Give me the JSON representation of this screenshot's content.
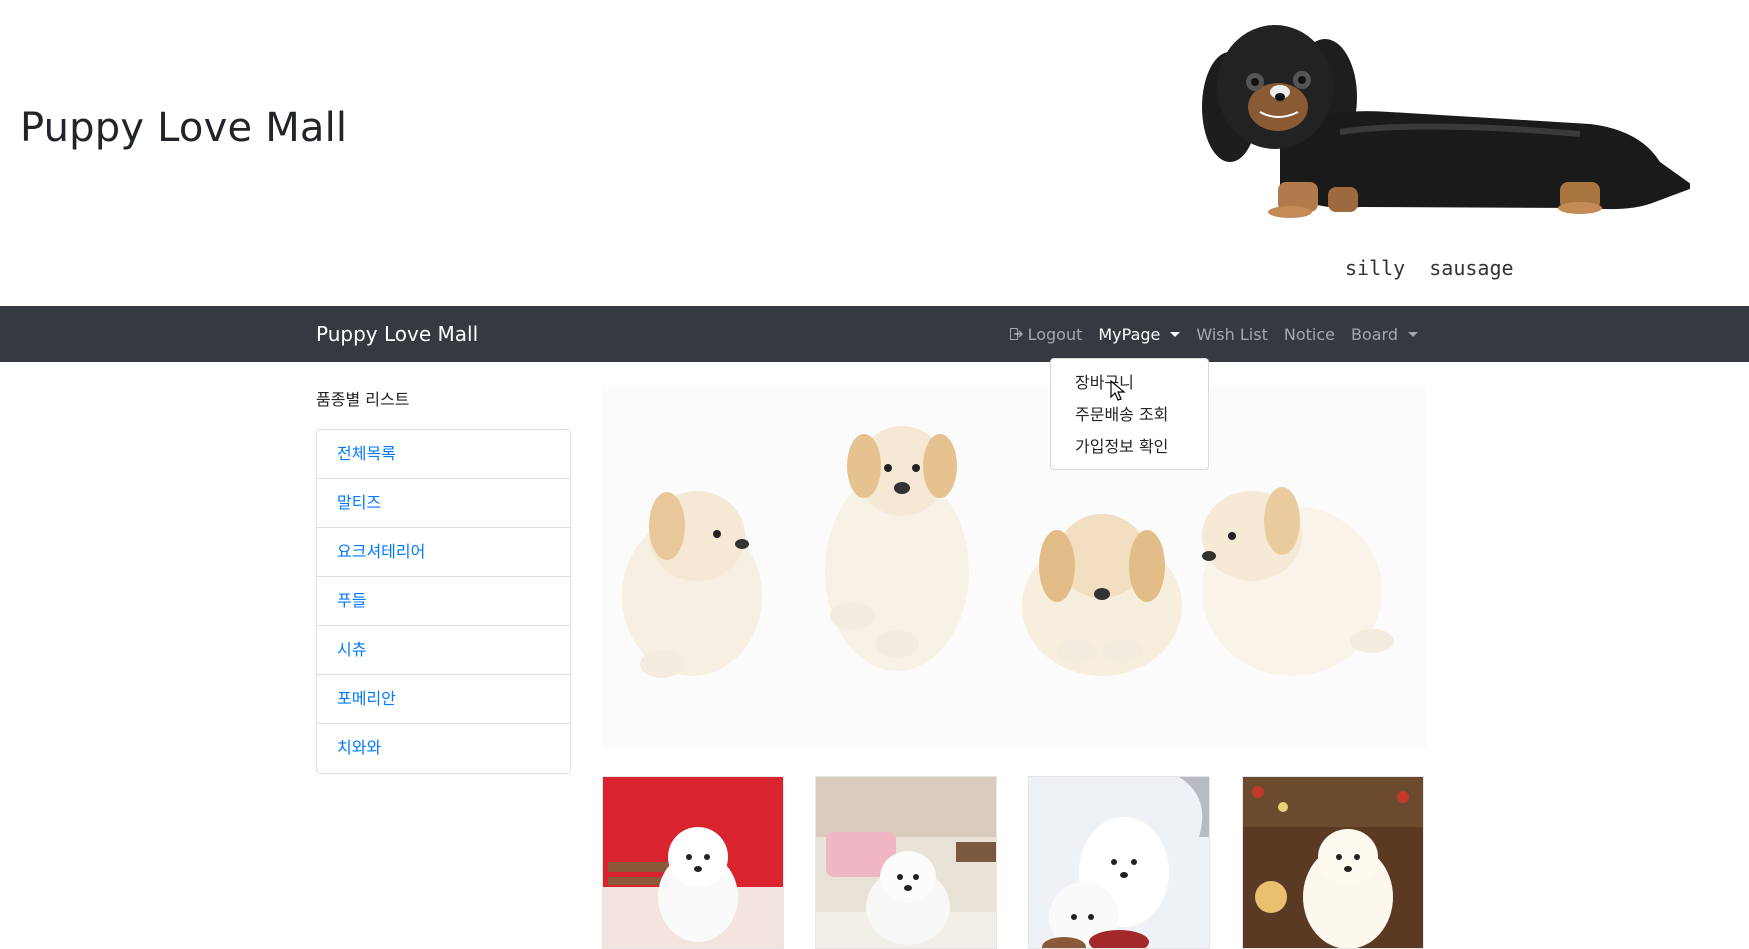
{
  "banner": {
    "title": "Puppy Love Mall",
    "art_caption": "silly  sausage",
    "art_icon": "dachshund-illustration"
  },
  "navbar": {
    "brand": "Puppy Love Mall",
    "logout_label": "Logout",
    "logout_icon": "sign-out-icon",
    "mypage_label": "MyPage",
    "wishlist_label": "Wish List",
    "notice_label": "Notice",
    "board_label": "Board",
    "background_color": "#343a40"
  },
  "mypage_menu": {
    "items": [
      {
        "label": "장바구니"
      },
      {
        "label": "주문배송 조회"
      },
      {
        "label": "가입정보 확인"
      }
    ]
  },
  "sidebar": {
    "heading": "품종별 리스트",
    "items": [
      {
        "label": "전체목록"
      },
      {
        "label": "말티즈"
      },
      {
        "label": "요크셔테리어"
      },
      {
        "label": "푸들"
      },
      {
        "label": "시츄"
      },
      {
        "label": "포메리안"
      },
      {
        "label": "치와와"
      }
    ],
    "link_color": "#007bff"
  },
  "carousel": {
    "image": "four-puppies-photo"
  },
  "products": [
    {
      "image": "white-puppy-red-background"
    },
    {
      "image": "white-puppy-pink-sofa"
    },
    {
      "image": "two-white-puppies"
    },
    {
      "image": "white-puppy-christmas"
    }
  ]
}
